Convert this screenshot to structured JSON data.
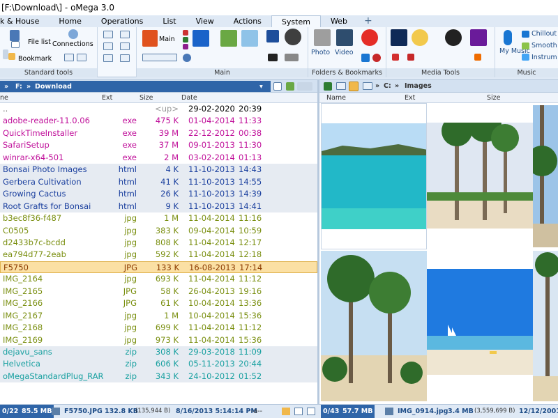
{
  "window": {
    "title": "[F:\\Download\\] - oMega 3.0"
  },
  "menu": {
    "tabs": [
      "k & House",
      "Home",
      "Operations",
      "List",
      "View",
      "Actions",
      "System",
      "Web"
    ],
    "active": "System",
    "plus": "+"
  },
  "ribbon": {
    "file_list": "File list",
    "connections": "Connections",
    "bookmark": "Bookmark",
    "main_label": "Main",
    "photo": "Photo",
    "video": "Video",
    "my_music": "My Music",
    "chillout": "Chillout",
    "smooth": "Smooth J",
    "instrumental": "Instrum",
    "groups": {
      "standard_tools": "Standard tools",
      "main": "Main",
      "folders_bookmarks": "Folders & Bookmarks",
      "media_tools": "Media Tools",
      "music": "Music"
    }
  },
  "left_panel": {
    "drive": "F:",
    "folder": "Download",
    "columns": {
      "name": "ne",
      "ext": "Ext",
      "size": "Size",
      "date": "Date"
    },
    "rows": [
      {
        "name": "..",
        "ext": "",
        "size": "<up>",
        "date": "29-02-2020",
        "time": "20:39",
        "type": "up"
      },
      {
        "name": "adobe-reader-11.0.06",
        "ext": "exe",
        "size": "475 K",
        "date": "01-04-2014",
        "time": "11:33",
        "type": "exe"
      },
      {
        "name": "QuickTimeInstaller",
        "ext": "exe",
        "size": "39 M",
        "date": "22-12-2012",
        "time": "00:38",
        "type": "exe"
      },
      {
        "name": "SafariSetup",
        "ext": "exe",
        "size": "37 M",
        "date": "09-01-2013",
        "time": "11:30",
        "type": "exe"
      },
      {
        "name": "winrar-x64-501",
        "ext": "exe",
        "size": "2 M",
        "date": "03-02-2014",
        "time": "01:13",
        "type": "exe"
      },
      {
        "name": "Bonsai Photo Images",
        "ext": "html",
        "size": "4 K",
        "date": "11-10-2013",
        "time": "14:43",
        "type": "html"
      },
      {
        "name": "Gerbera Cultivation",
        "ext": "html",
        "size": "41 K",
        "date": "11-10-2013",
        "time": "14:55",
        "type": "html"
      },
      {
        "name": "Growing Cactus",
        "ext": "html",
        "size": "26 K",
        "date": "11-10-2013",
        "time": "14:39",
        "type": "html"
      },
      {
        "name": "Root Grafts for Bonsai",
        "ext": "html",
        "size": "9 K",
        "date": "11-10-2013",
        "time": "14:41",
        "type": "html"
      },
      {
        "name": "b3ec8f36-f487",
        "ext": "jpg",
        "size": "1 M",
        "date": "11-04-2014",
        "time": "11:16",
        "type": "jpg"
      },
      {
        "name": "C0505",
        "ext": "jpg",
        "size": "383 K",
        "date": "09-04-2014",
        "time": "10:59",
        "type": "jpg"
      },
      {
        "name": "d2433b7c-bcdd",
        "ext": "jpg",
        "size": "808 K",
        "date": "11-04-2014",
        "time": "12:17",
        "type": "jpg"
      },
      {
        "name": "ea794d77-2eab",
        "ext": "jpg",
        "size": "592 K",
        "date": "11-04-2014",
        "time": "12:18",
        "type": "jpg"
      },
      {
        "name": "F5750",
        "ext": "JPG",
        "size": "133 K",
        "date": "16-08-2013",
        "time": "17:14",
        "type": "sel"
      },
      {
        "name": "IMG_2164",
        "ext": "jpg",
        "size": "693 K",
        "date": "11-04-2014",
        "time": "11:12",
        "type": "jpg"
      },
      {
        "name": "IMG_2165",
        "ext": "JPG",
        "size": "58 K",
        "date": "26-04-2013",
        "time": "19:16",
        "type": "jpg"
      },
      {
        "name": "IMG_2166",
        "ext": "JPG",
        "size": "61 K",
        "date": "10-04-2014",
        "time": "13:36",
        "type": "jpg"
      },
      {
        "name": "IMG_2167",
        "ext": "jpg",
        "size": "1 M",
        "date": "10-04-2014",
        "time": "15:36",
        "type": "jpg"
      },
      {
        "name": "IMG_2168",
        "ext": "jpg",
        "size": "699 K",
        "date": "11-04-2014",
        "time": "11:12",
        "type": "jpg"
      },
      {
        "name": "IMG_2169",
        "ext": "jpg",
        "size": "973 K",
        "date": "11-04-2014",
        "time": "15:36",
        "type": "jpg"
      },
      {
        "name": "dejavu_sans",
        "ext": "zip",
        "size": "308 K",
        "date": "29-03-2018",
        "time": "11:09",
        "type": "zip"
      },
      {
        "name": "Helvetica",
        "ext": "zip",
        "size": "606 K",
        "date": "05-11-2013",
        "time": "20:44",
        "type": "zip"
      },
      {
        "name": "oMegaStandardPlug_RAR",
        "ext": "zip",
        "size": "343 K",
        "date": "24-10-2012",
        "time": "01:52",
        "type": "zip"
      }
    ]
  },
  "right_panel": {
    "drive": "C:",
    "folder": "Images",
    "columns": {
      "name": "Name",
      "ext": "Ext",
      "size": "Size"
    }
  },
  "status": {
    "left_count": "0/22",
    "left_size": "85.5 MB",
    "left_file": "F5750.JPG",
    "left_filesize": "132.8 KB",
    "left_bytes": "(135,944 B)",
    "left_date": "8/16/2013 5:14:14 PM",
    "left_attr": "-a--",
    "right_count": "0/43",
    "right_size": "57.7 MB",
    "right_file": "IMG_0914.jpg",
    "right_filesize": "3.4 MB",
    "right_bytes": "(3,559,699 B)",
    "right_date": "12/12/2001 4"
  },
  "colors": {
    "exe": "#c0109a",
    "html": "#1a3f9e",
    "jpg": "#7a8f10",
    "zip": "#18a0a0",
    "up": "#666666",
    "sel": "#8a3a00"
  }
}
